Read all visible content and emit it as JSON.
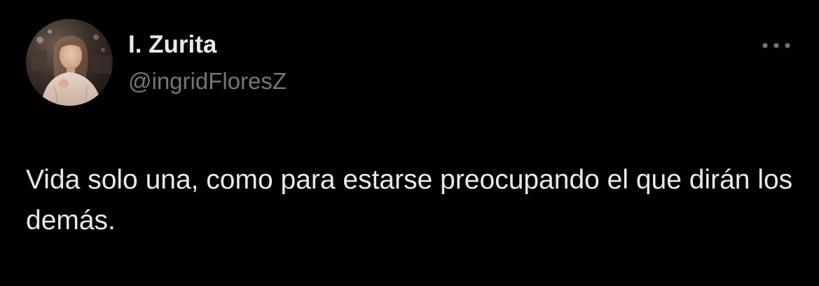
{
  "tweet": {
    "author": {
      "display_name": "I. Zurita",
      "handle": "@ingridFloresZ",
      "avatar_icon": "profile-photo"
    },
    "more_icon": "more-horizontal-icon",
    "text": "Vida solo una, como para estarse preocupando el que dirán los demás."
  },
  "colors": {
    "background": "#000000",
    "primary_text": "#e7e9ea",
    "secondary_text": "#71767b"
  }
}
